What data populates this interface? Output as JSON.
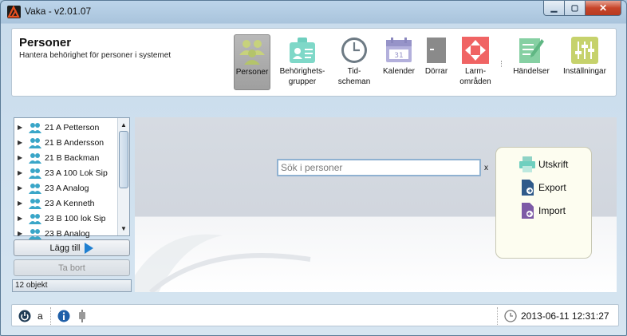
{
  "window": {
    "title": "Vaka - v2.01.07",
    "controls": {
      "minimize": "▁",
      "maximize": "▢",
      "close": "✕"
    }
  },
  "header": {
    "title": "Personer",
    "subtitle": "Hantera behörighet för personer i systemet"
  },
  "toolbar": [
    {
      "line1": "Personer",
      "line2": "",
      "icon": "persons-icon",
      "color": "#b8c970",
      "active": true
    },
    {
      "line1": "Behörighets-",
      "line2": "grupper",
      "icon": "badge-icon",
      "color": "#6fcfbf",
      "active": false
    },
    {
      "line1": "Tid-",
      "line2": "scheman",
      "icon": "clock-icon",
      "color": "#7a8a94",
      "active": false
    },
    {
      "line1": "Kalender",
      "line2": "",
      "icon": "calendar-icon",
      "color": "#a9a6d4",
      "active": false
    },
    {
      "line1": "Dörrar",
      "line2": "",
      "icon": "door-icon",
      "color": "#8a8a8a",
      "active": false
    },
    {
      "line1": "Larm-",
      "line2": "områden",
      "icon": "alarm-area-icon",
      "color": "#ef5a5a",
      "active": false
    },
    {
      "line1": "Händelser",
      "line2": "",
      "icon": "events-icon",
      "color": "#7cc99a",
      "active": false
    },
    {
      "line1": "Inställningar",
      "line2": "",
      "icon": "settings-icon",
      "color": "#c2cf6a",
      "active": false
    }
  ],
  "person_list": {
    "items": [
      "21 A Petterson",
      "21 B Andersson",
      "21 B Backman",
      "23 A 100 Lok Sip",
      "23 A Analog",
      "23 A Kenneth",
      "23 B 100 lok Sip",
      "23 B Analog"
    ],
    "scroll_up": "▲",
    "scroll_down": "▼",
    "expand_glyph": "▶"
  },
  "buttons": {
    "add": "Lägg till",
    "remove": "Ta bort"
  },
  "count_label": "12 objekt",
  "search": {
    "placeholder": "Sök i personer",
    "clear": "x"
  },
  "actions": {
    "print": "Utskrift",
    "export": "Export",
    "import": "Import"
  },
  "statusbar": {
    "user": "a",
    "datetime": "2013-06-11 12:31:27"
  },
  "colors": {
    "accent_blue": "#1f7fd0",
    "person_icon": "#3aa6c8"
  }
}
